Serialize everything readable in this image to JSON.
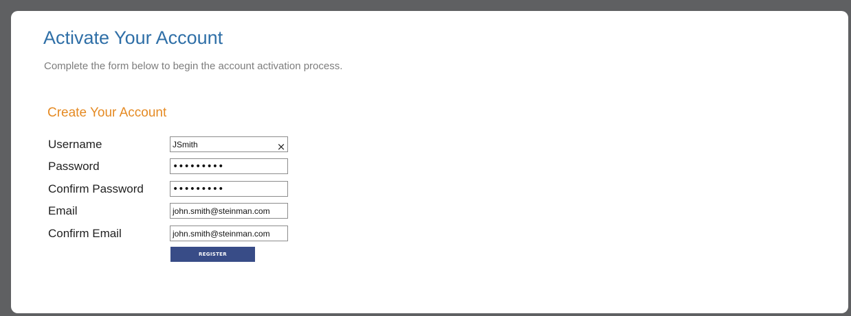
{
  "header": {
    "title": "Activate Your Account",
    "subtitle": "Complete the form below to begin the account activation process."
  },
  "form": {
    "section_title": "Create Your Account",
    "fields": {
      "username": {
        "label": "Username",
        "value": "JSmith"
      },
      "password": {
        "label": "Password",
        "value": "•••••••••"
      },
      "confirm_password": {
        "label": "Confirm Password",
        "value": "•••••••••"
      },
      "email": {
        "label": "Email",
        "value": "john.smith@steinman.com"
      },
      "confirm_email": {
        "label": "Confirm Email",
        "value": "john.smith@steinman.com"
      }
    },
    "clear_glyph": "×",
    "register_label": "REGISTER"
  },
  "colors": {
    "title": "#2f6fa7",
    "section_title": "#e58a23",
    "button": "#384c87",
    "frame": "#5f6062"
  },
  "icons": {
    "clear": "close-icon"
  }
}
